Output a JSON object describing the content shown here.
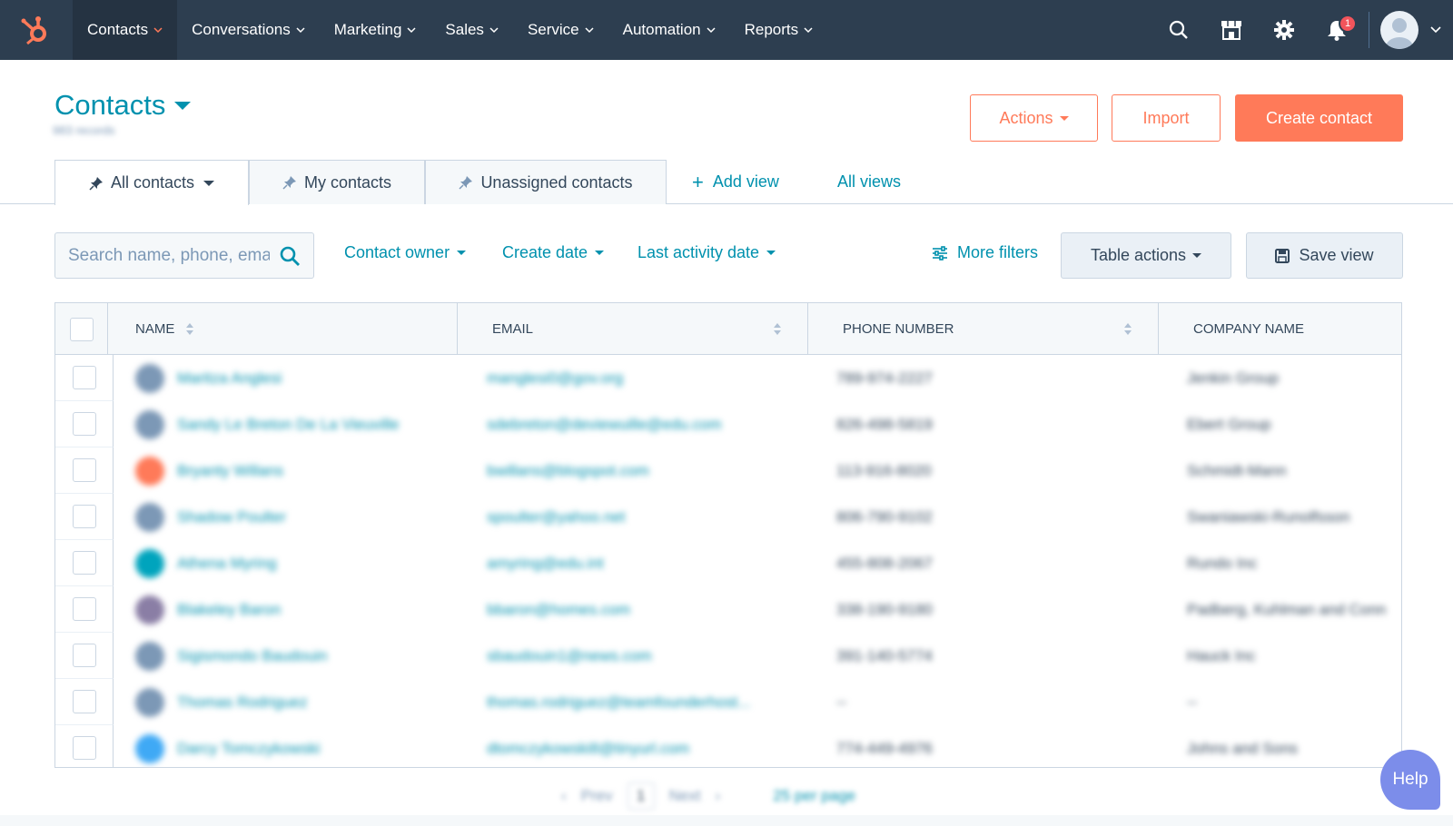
{
  "nav": {
    "items": [
      {
        "label": "Contacts",
        "active": true
      },
      {
        "label": "Conversations",
        "active": false
      },
      {
        "label": "Marketing",
        "active": false
      },
      {
        "label": "Sales",
        "active": false
      },
      {
        "label": "Service",
        "active": false
      },
      {
        "label": "Automation",
        "active": false
      },
      {
        "label": "Reports",
        "active": false
      }
    ],
    "notification_count": "1",
    "icons": [
      "hubspot-logo-icon",
      "search-icon",
      "marketplace-icon",
      "gear-icon",
      "bell-icon",
      "user-avatar-icon",
      "chevron-down-icon"
    ]
  },
  "header": {
    "title": "Contacts",
    "record_count": "983 records",
    "actions_label": "Actions",
    "import_label": "Import",
    "create_label": "Create contact"
  },
  "tabs": {
    "items": [
      {
        "label": "All contacts",
        "active": true
      },
      {
        "label": "My contacts",
        "active": false
      },
      {
        "label": "Unassigned contacts",
        "active": false
      }
    ],
    "add_view_label": "Add view",
    "all_views_label": "All views"
  },
  "filters": {
    "search_placeholder": "Search name, phone, email",
    "contact_owner_label": "Contact owner",
    "create_date_label": "Create date",
    "last_activity_label": "Last activity date",
    "more_filters_label": "More filters",
    "table_actions_label": "Table actions",
    "save_view_label": "Save view"
  },
  "table": {
    "columns": [
      "NAME",
      "EMAIL",
      "PHONE NUMBER",
      "COMPANY NAME"
    ],
    "rows": [
      {
        "name": "Maritza Anglesi",
        "email": "manglesi0@gov.org",
        "phone": "789-974-2227",
        "company": "Jenkin Group",
        "avatar_color": "#7c98b6"
      },
      {
        "name": "Sandy Le Breton De La Vieuville",
        "email": "sdebreton@deviewuille@edu.com",
        "phone": "826-498-5819",
        "company": "Ebert Group",
        "avatar_color": "#7c98b6"
      },
      {
        "name": "Bryanty Willans",
        "email": "bwillans@blogspot.com",
        "phone": "113-916-8020",
        "company": "Schmidt-Mann",
        "avatar_color": "#ff7a59"
      },
      {
        "name": "Shadow Poulter",
        "email": "spoulter@yahoo.net",
        "phone": "806-790-9102",
        "company": "Swaniawski-Runolfsson",
        "avatar_color": "#7c98b6"
      },
      {
        "name": "Athena Myring",
        "email": "amyring@edu.int",
        "phone": "455-808-2067",
        "company": "Rundo Inc",
        "avatar_color": "#00a4bd"
      },
      {
        "name": "Blakeley Baron",
        "email": "bbaron@homes.com",
        "phone": "338-190-9180",
        "company": "Padberg, Kuhlman and Conn",
        "avatar_color": "#8a7ea5"
      },
      {
        "name": "Sigismondo Baudouin",
        "email": "sbaudouin1@news.com",
        "phone": "391-140-5774",
        "company": "Hauck Inc",
        "avatar_color": "#7c98b6"
      },
      {
        "name": "Thomas Rodriguez",
        "email": "thomas.rodriguez@teamfounderhost...",
        "phone": "--",
        "company": "--",
        "avatar_color": "#7c98b6"
      },
      {
        "name": "Darcy Tomczykowski",
        "email": "dtomczykowski8@tinyurl.com",
        "phone": "774-449-4976",
        "company": "Johns and Sons",
        "avatar_color": "#3fa9f5"
      }
    ]
  },
  "pagination": {
    "prev_label": "Prev",
    "page": "1",
    "next_label": "Next",
    "per_page_label": "25 per page"
  },
  "help": {
    "label": "Help"
  },
  "colors": {
    "nav_bg": "#2d3e50",
    "accent": "#ff7a59",
    "link": "#0091ae",
    "text": "#33475b",
    "border": "#cbd6e2",
    "help_bg": "#7c8dea"
  }
}
